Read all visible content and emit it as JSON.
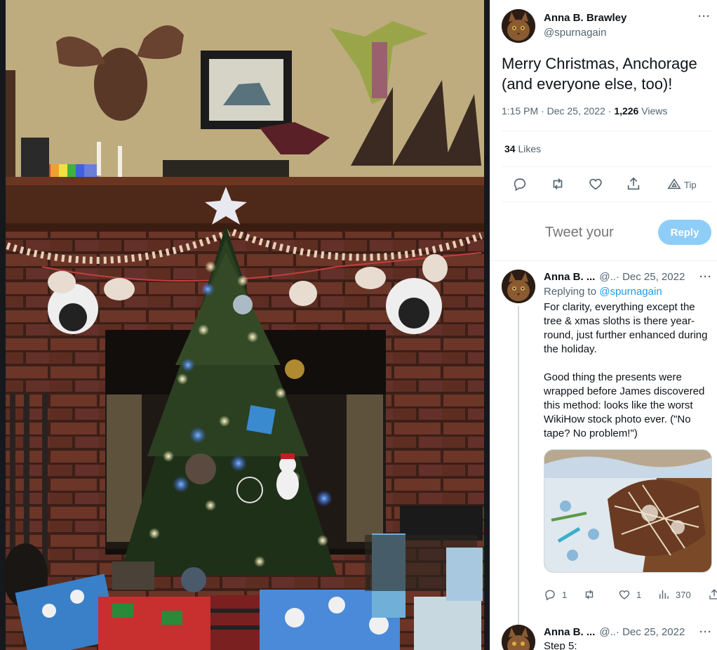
{
  "photo": {
    "alt_icon": "christmas-fireplace-photo"
  },
  "tweet": {
    "author_name": "Anna B. Brawley",
    "author_handle": "@spurnagain",
    "text": "Merry Christmas, Anchorage (and everyone else, too)!",
    "time": "1:15 PM · Dec 25, 2022 · ",
    "views_count": "1,226",
    "views_label": " Views",
    "likes_count": "34",
    "likes_label": " Likes",
    "tip_label": "Tip",
    "more": "···"
  },
  "reply_composer": {
    "placeholder": "Tweet your",
    "button": "Reply"
  },
  "reply": {
    "author_name": "Anna B. ...",
    "meta": "@..· Dec 25, 2022",
    "replying_prefix": "Replying to ",
    "replying_handle": "@spurnagain",
    "para1": "For clarity, everything except the tree & xmas sloths is there year-round, just further enhanced during the holiday.",
    "para2": "Good thing the presents were wrapped before James discovered this method: looks like the worst WikiHow stock photo ever. (\"No tape? No problem!\")",
    "reply_count": "1",
    "retweet_count": "",
    "like_count": "1",
    "views_count": "370",
    "more": "···"
  },
  "next_reply": {
    "author_name": "Anna B. ...",
    "meta": "@..· Dec 25, 2022",
    "text": "Step 5:",
    "more": "···"
  },
  "colors": {
    "accent": "#1d9bf0",
    "reply_button": "#8ecdf8",
    "muted": "#536471"
  }
}
